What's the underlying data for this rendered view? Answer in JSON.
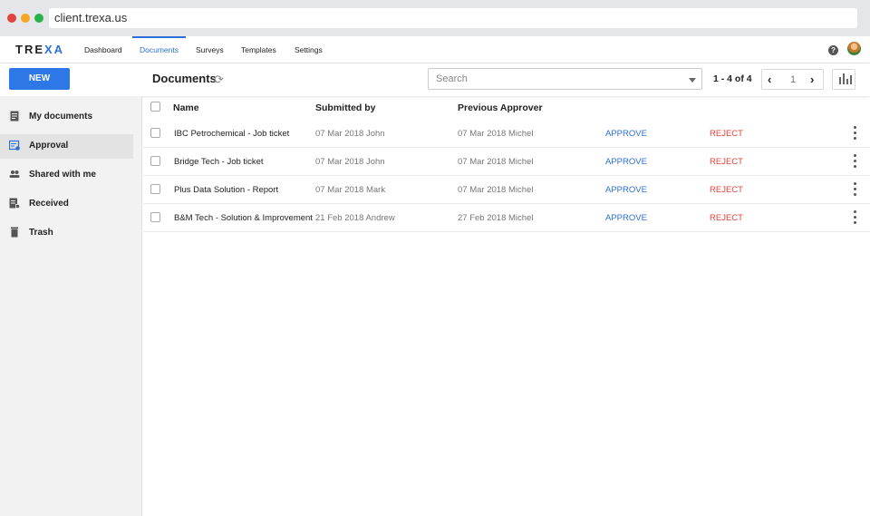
{
  "browser": {
    "url": "client.trexa.us"
  },
  "nav": {
    "logo_main": "TRE",
    "logo_accent": "XA",
    "items": [
      {
        "label": "Dashboard"
      },
      {
        "label": "Documents",
        "active": true
      },
      {
        "label": "Surveys"
      },
      {
        "label": "Templates"
      },
      {
        "label": "Settings"
      }
    ],
    "help_glyph": "?"
  },
  "toolbar": {
    "new_label": "NEW",
    "title": "Documents",
    "search_placeholder": "Search",
    "pager_range": "1 - 4 of 4",
    "page_number": "1",
    "prev_glyph": "‹",
    "next_glyph": "›",
    "refresh_glyph": "⟳"
  },
  "sidebar": {
    "items": [
      {
        "label": "My documents",
        "icon": "document-icon"
      },
      {
        "label": "Approval",
        "icon": "approval-icon",
        "active": true
      },
      {
        "label": "Shared with me",
        "icon": "people-icon"
      },
      {
        "label": "Received",
        "icon": "inbox-icon"
      },
      {
        "label": "Trash",
        "icon": "trash-icon"
      }
    ]
  },
  "table": {
    "headers": {
      "name": "Name",
      "submitted_by": "Submitted by",
      "previous_approver": "Previous Approver",
      "sort_glyph": "↓"
    },
    "rows": [
      {
        "name": "IBC Petrochemical - Job ticket",
        "submitted": "07 Mar 2018 John",
        "previous": "07 Mar 2018 Michel",
        "approve": "APPROVE",
        "reject": "REJECT"
      },
      {
        "name": "Bridge Tech - Job ticket",
        "submitted": "07 Mar 2018 John",
        "previous": "07 Mar 2018 Michel",
        "approve": "APPROVE",
        "reject": "REJECT"
      },
      {
        "name": "Plus Data Solution - Report",
        "submitted": "07 Mar 2018 Mark",
        "previous": "07 Mar 2018 Michel",
        "approve": "APPROVE",
        "reject": "REJECT"
      },
      {
        "name": "B&M Tech - Solution & Improvement",
        "submitted": "21 Feb 2018 Andrew",
        "previous": "27 Feb 2018 Michel",
        "approve": "APPROVE",
        "reject": "REJECT"
      }
    ]
  },
  "colors": {
    "accent": "#2d6fd8",
    "reject": "#e0443e",
    "new_button": "#2d78e6"
  }
}
